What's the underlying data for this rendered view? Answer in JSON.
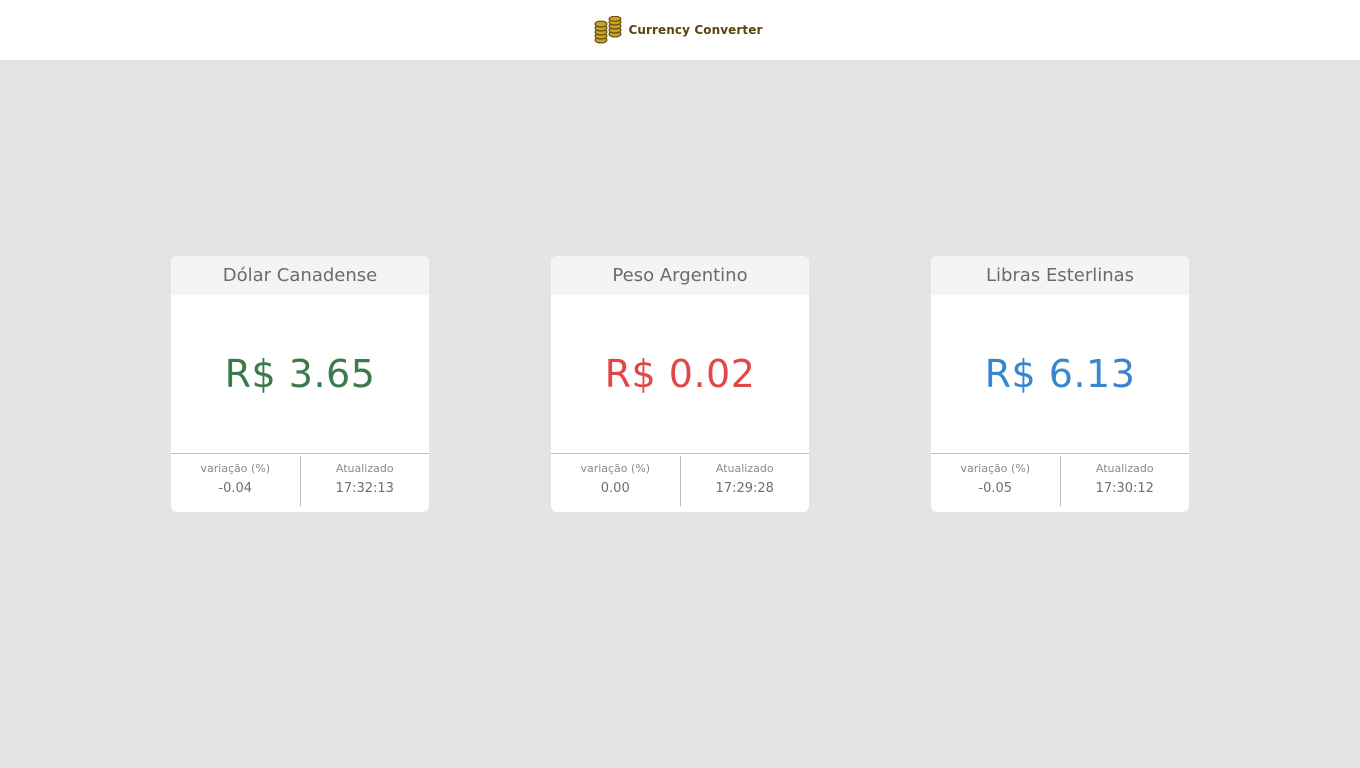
{
  "header": {
    "title": "Currency Converter",
    "logo_icon": "coin-stacks-icon",
    "title_color": "#5a4708"
  },
  "cards": [
    {
      "name": "Dólar Canadense",
      "price": "R$ 3.65",
      "price_color": "#3b7a4a",
      "variation_label": "variação (%)",
      "variation": "-0.04",
      "updated_label": "Atualizado",
      "updated": "17:32:13"
    },
    {
      "name": "Peso Argentino",
      "price": "R$ 0.02",
      "price_color": "#e04848",
      "variation_label": "variação (%)",
      "variation": "0.00",
      "updated_label": "Atualizado",
      "updated": "17:29:28"
    },
    {
      "name": "Libras Esterlinas",
      "price": "R$ 6.13",
      "price_color": "#3a85d0",
      "variation_label": "variação (%)",
      "variation": "-0.05",
      "updated_label": "Atualizado",
      "updated": "17:30:12"
    }
  ]
}
